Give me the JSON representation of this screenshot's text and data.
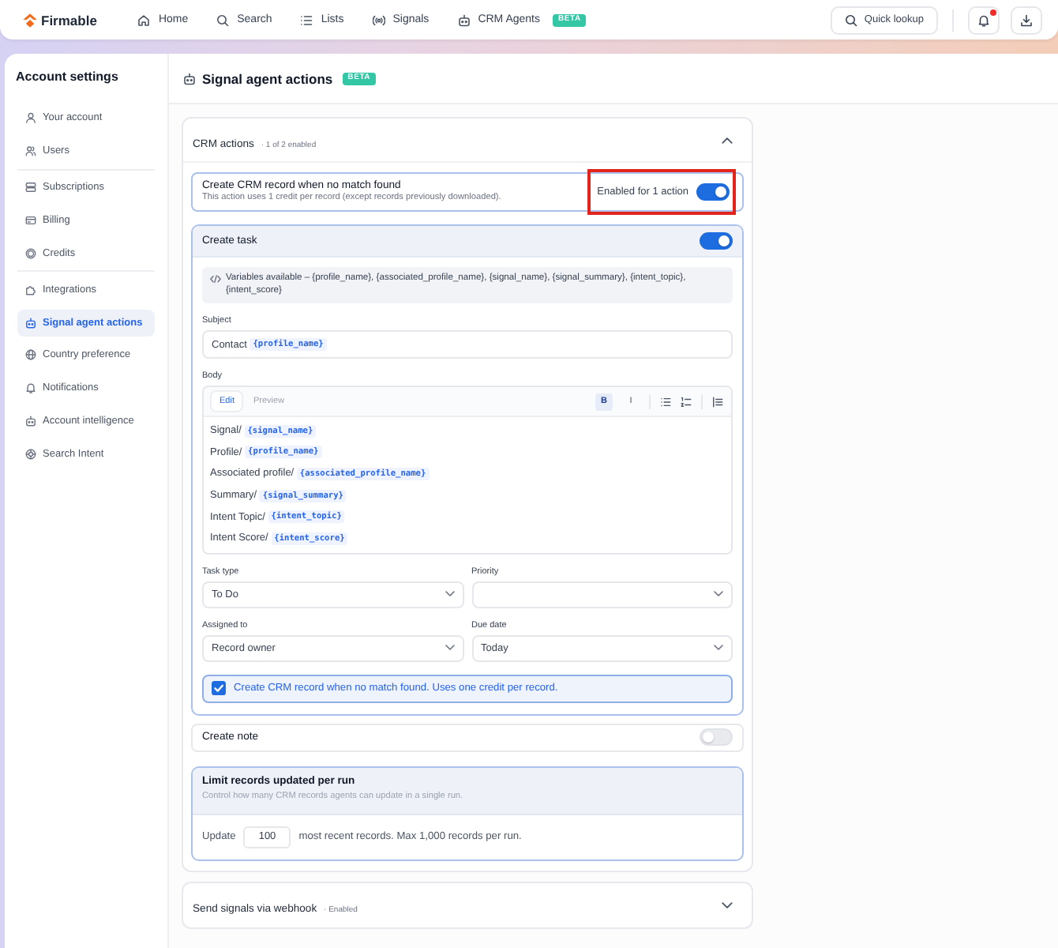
{
  "topbar": {
    "brand": "Firmable",
    "nav": [
      {
        "label": "Home"
      },
      {
        "label": "Search"
      },
      {
        "label": "Lists"
      },
      {
        "label": "Signals"
      },
      {
        "label": "CRM Agents",
        "badge": "BETA"
      }
    ],
    "quick_lookup": "Quick lookup",
    "notifications": {
      "unread": true
    }
  },
  "sidebar": {
    "title": "Account settings",
    "groups": [
      {
        "items": [
          {
            "label": "Your account",
            "selected": false
          },
          {
            "label": "Users",
            "selected": false
          }
        ]
      },
      {
        "items": [
          {
            "label": "Subscriptions",
            "selected": false
          },
          {
            "label": "Billing",
            "selected": false
          },
          {
            "label": "Credits",
            "selected": false
          }
        ]
      },
      {
        "items": [
          {
            "label": "Integrations",
            "selected": false
          },
          {
            "label": "Signal agent actions",
            "selected": true
          },
          {
            "label": "Country preference",
            "selected": false
          },
          {
            "label": "Notifications",
            "selected": false
          },
          {
            "label": "Account intelligence",
            "selected": false
          },
          {
            "label": "Search Intent",
            "selected": false
          }
        ]
      }
    ]
  },
  "page": {
    "title": "Signal agent actions",
    "badge": "BETA"
  },
  "crm_actions": {
    "title": "CRM actions",
    "summary": "· 1 of 2 enabled",
    "expanded": true,
    "create_record": {
      "title": "Create CRM record when no match found",
      "description": "This action uses 1 credit per record (except records previously downloaded).",
      "status": "Enabled for 1 action",
      "on": true,
      "highlighted": true
    },
    "create_task": {
      "title": "Create task",
      "on": true,
      "variables": "Variables available – {profile_name}, {associated_profile_name}, {signal_name}, {signal_summary}, {intent_topic}, {intent_score}",
      "subject": {
        "label": "Subject",
        "value": "Contact {profile_name}"
      },
      "body": {
        "label": "Body",
        "tabs": [
          {
            "label": "Edit",
            "selected": true
          },
          {
            "label": "Preview",
            "selected": false
          }
        ],
        "format_buttons": [
          {
            "label": "B",
            "selected": true
          },
          {
            "label": "I",
            "selected": false
          }
        ],
        "lines": [
          "Signal/ {signal_name}",
          "Profile/ {profile_name}",
          "Associated profile/ {associated_profile_name}",
          "Summary/ {signal_summary}",
          "Intent Topic/ {intent_topic}",
          "Intent Score/ {intent_score}"
        ]
      },
      "fields": [
        {
          "label": "Task type",
          "value": "To Do"
        },
        {
          "label": "Priority"
        },
        {
          "label": "Assigned to",
          "value": "Record owner"
        },
        {
          "label": "Due date",
          "value": "Today"
        }
      ],
      "create_record_option": {
        "label": "Create CRM record when no match found. Uses one credit per record.",
        "checked": true
      }
    },
    "create_note": {
      "title": "Create note",
      "on": false
    },
    "limit": {
      "title": "Limit records updated per run",
      "description": "Control how many CRM records agents can update in a single run.",
      "prefix": "Update",
      "value": "100",
      "suffix": "most recent records. Max 1,000 records per run."
    }
  },
  "webhook": {
    "title": "Send signals via webhook",
    "summary": "· Enabled",
    "expanded": false
  }
}
